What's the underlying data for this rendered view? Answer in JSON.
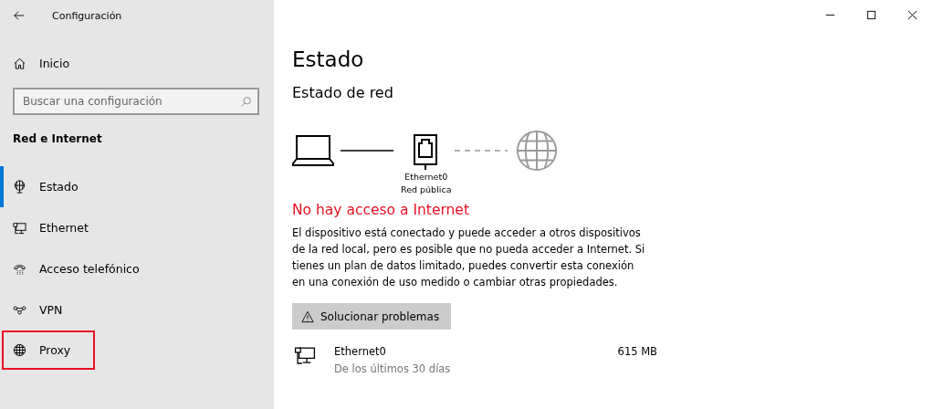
{
  "window": {
    "title": "Configuración"
  },
  "sidebar": {
    "home": {
      "label": "Inicio"
    },
    "search": {
      "placeholder": "Buscar una configuración"
    },
    "section_title": "Red e Internet",
    "items": [
      {
        "label": "Estado",
        "kind": "status",
        "selected": true,
        "highlighted": false
      },
      {
        "label": "Ethernet",
        "kind": "ethernet",
        "selected": false,
        "highlighted": false
      },
      {
        "label": "Acceso telefónico",
        "kind": "dialup",
        "selected": false,
        "highlighted": false
      },
      {
        "label": "VPN",
        "kind": "vpn",
        "selected": false,
        "highlighted": false
      },
      {
        "label": "Proxy",
        "kind": "proxy",
        "selected": false,
        "highlighted": true
      }
    ]
  },
  "main": {
    "title": "Estado",
    "subtitle": "Estado de red",
    "diagram": {
      "adapter": "Ethernet0",
      "network": "Red pública",
      "internet_connected": false
    },
    "status_heading": "No hay acceso a Internet",
    "description": "El dispositivo está conectado y puede acceder a otros dispositivos de la red local, pero es posible que no pueda acceder a Internet. Si tienes un plan de datos limitado, puedes convertir esta conexión en una conexión de uso medido o cambiar otras propiedades.",
    "troubleshoot_button": "Solucionar problemas",
    "usage": {
      "name": "Ethernet0",
      "period": "De los últimos 30 días",
      "amount": "615 MB"
    }
  }
}
